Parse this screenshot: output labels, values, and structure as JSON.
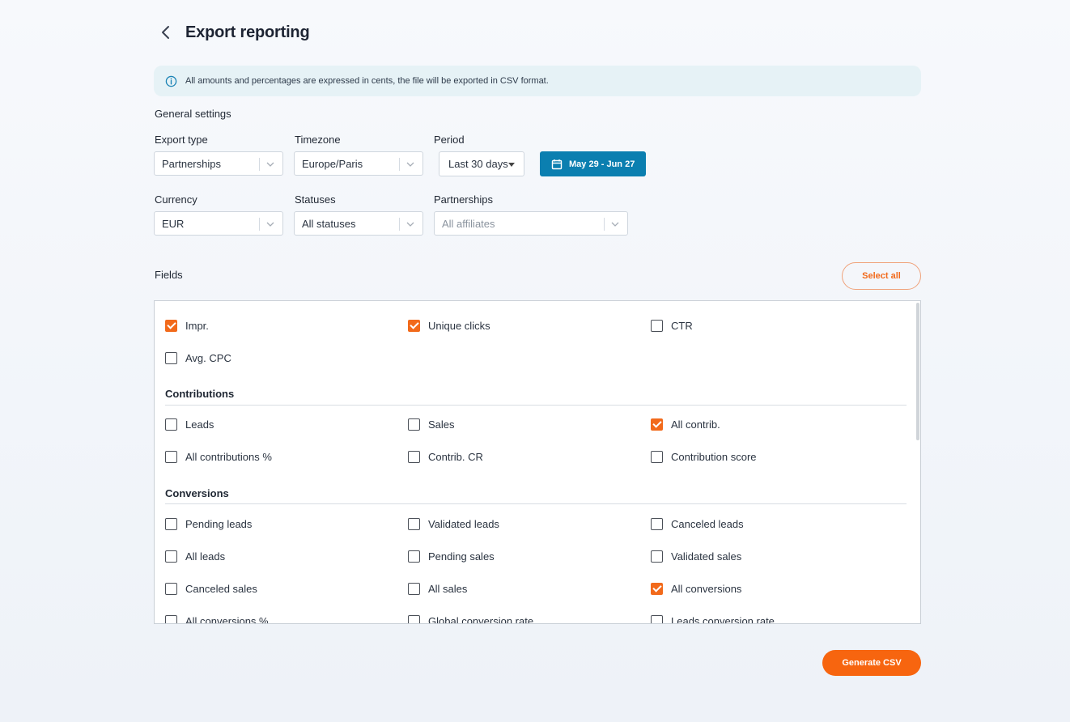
{
  "header": {
    "title": "Export reporting"
  },
  "info": {
    "text": "All amounts and percentages are expressed in cents, the file will be exported in CSV format."
  },
  "general": {
    "title": "General settings",
    "export_type": {
      "label": "Export type",
      "value": "Partnerships"
    },
    "timezone": {
      "label": "Timezone",
      "value": "Europe/Paris"
    },
    "period": {
      "label": "Period",
      "value": "Last 30 days",
      "range": "May 29 - Jun 27"
    },
    "currency": {
      "label": "Currency",
      "value": "EUR"
    },
    "statuses": {
      "label": "Statuses",
      "value": "All statuses"
    },
    "partnerships": {
      "label": "Partnerships",
      "placeholder": "All affiliates"
    }
  },
  "fields": {
    "title": "Fields",
    "select_all": "Select all",
    "top": [
      {
        "label": "Impr.",
        "checked": true
      },
      {
        "label": "Unique clicks",
        "checked": true
      },
      {
        "label": "CTR",
        "checked": false
      },
      {
        "label": "Avg. CPC",
        "checked": false
      }
    ],
    "contributions": {
      "title": "Contributions",
      "items": [
        {
          "label": "Leads",
          "checked": false
        },
        {
          "label": "Sales",
          "checked": false
        },
        {
          "label": "All contrib.",
          "checked": true
        },
        {
          "label": "All contributions %",
          "checked": false
        },
        {
          "label": "Contrib. CR",
          "checked": false
        },
        {
          "label": "Contribution score",
          "checked": false
        }
      ]
    },
    "conversions": {
      "title": "Conversions",
      "items": [
        {
          "label": "Pending leads",
          "checked": false
        },
        {
          "label": "Validated leads",
          "checked": false
        },
        {
          "label": "Canceled leads",
          "checked": false
        },
        {
          "label": "All leads",
          "checked": false
        },
        {
          "label": "Pending sales",
          "checked": false
        },
        {
          "label": "Validated sales",
          "checked": false
        },
        {
          "label": "Canceled sales",
          "checked": false
        },
        {
          "label": "All sales",
          "checked": false
        },
        {
          "label": "All conversions",
          "checked": true
        },
        {
          "label": "All conversions %",
          "checked": false
        },
        {
          "label": "Global conversion rate",
          "checked": false
        },
        {
          "label": "Leads conversion rate",
          "checked": false
        }
      ]
    }
  },
  "actions": {
    "generate": "Generate CSV"
  },
  "colors": {
    "accent": "#f26a1b",
    "date_button": "#0b7fb0",
    "banner": "#e6f2f6"
  }
}
